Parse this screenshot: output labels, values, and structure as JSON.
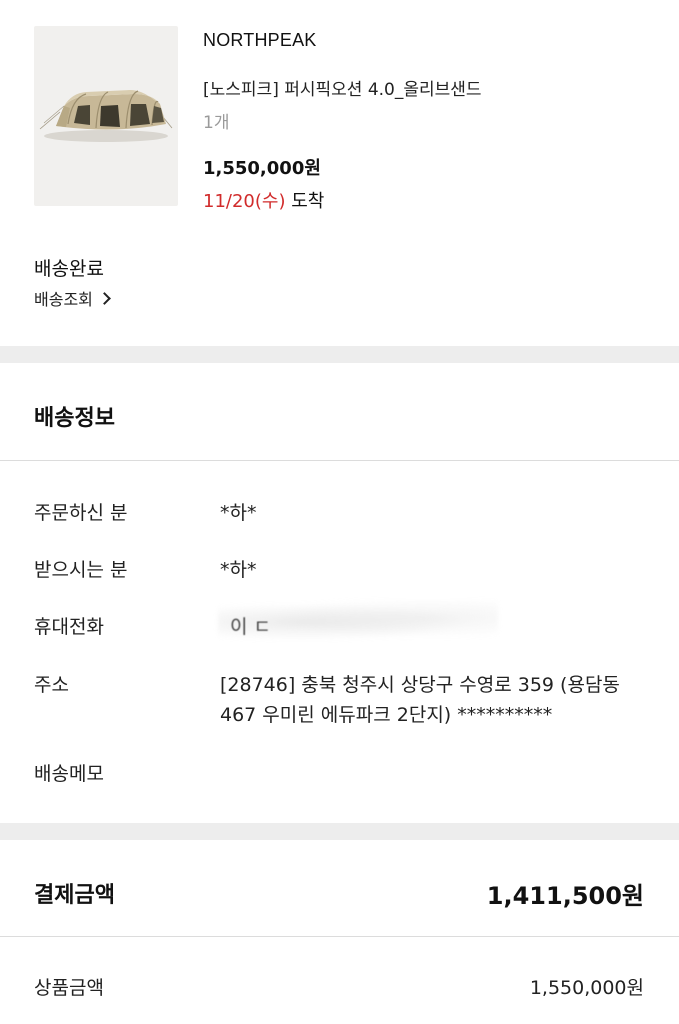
{
  "product": {
    "brand": "NORTHPEAK",
    "name": "[노스피크] 퍼시픽오션 4.0_올리브샌드",
    "quantity": "1개",
    "price": "1,550,000원",
    "arrival_date": "11/20(수)",
    "arrival_suffix": " 도착",
    "image_icon": "tent-product-image"
  },
  "delivery": {
    "status": "배송완료",
    "track_label": "배송조회"
  },
  "shipping_info": {
    "title": "배송정보",
    "rows": {
      "orderer": {
        "label": "주문하신 분",
        "value": "*하*"
      },
      "recipient": {
        "label": "받으시는 분",
        "value": "*하*"
      },
      "phone": {
        "label": "휴대전화",
        "value": "이  ㄷ"
      },
      "address": {
        "label": "주소",
        "value": "[28746] 충북 청주시 상당구 수영로 359 (용담동 467 우미린 에듀파크 2단지) **********"
      },
      "memo": {
        "label": "배송메모",
        "value": ""
      }
    }
  },
  "payment": {
    "title": "결제금액",
    "total": "1,411,500원",
    "product_amount_label": "상품금액",
    "product_amount": "1,550,000원"
  },
  "colors": {
    "accent_red": "#d12b2b",
    "section_gap": "#ededed",
    "divider": "#dcdcdc"
  }
}
